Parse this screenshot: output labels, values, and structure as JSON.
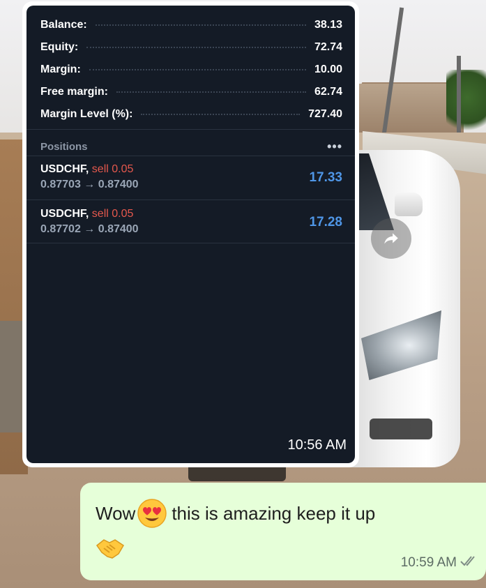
{
  "account": [
    {
      "label": "Balance:",
      "value": "38.13"
    },
    {
      "label": "Equity:",
      "value": "72.74"
    },
    {
      "label": "Margin:",
      "value": "10.00"
    },
    {
      "label": "Free margin:",
      "value": "62.74"
    },
    {
      "label": "Margin Level (%):",
      "value": "727.40"
    }
  ],
  "positions_header": {
    "title": "Positions",
    "more": "•••"
  },
  "positions": [
    {
      "symbol": "USDCHF,",
      "direction": "sell 0.05",
      "prices": "0.87703 → 0.87400",
      "profit": "17.33"
    },
    {
      "symbol": "USDCHF,",
      "direction": "sell 0.05",
      "prices": "0.87702 → 0.87400",
      "profit": "17.28"
    }
  ],
  "image_message": {
    "time": "10:56 AM"
  },
  "text_message": {
    "text_before": "Wow",
    "text_after": " this is amazing keep it up",
    "time": "10:59 AM",
    "status": "read"
  },
  "icons": {
    "forward": "forward-arrow-icon",
    "emoji": "heart-eyes-emoji-icon",
    "handshake": "handshake-emoji-icon",
    "read": "double-check-icon"
  },
  "colors": {
    "sell": "#e5584d",
    "profit": "#4f96e6",
    "bubble": "#e6ffd9",
    "terminal_bg": "#141b26"
  }
}
